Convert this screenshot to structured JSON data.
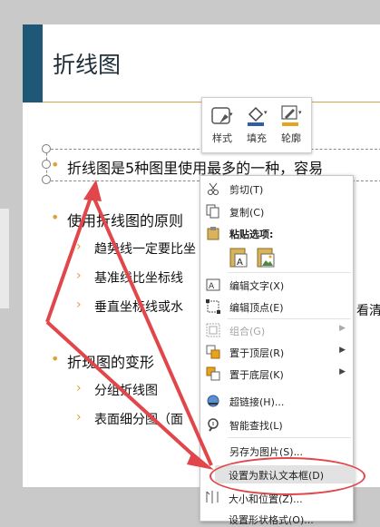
{
  "slide": {
    "title": "折线图",
    "bullets": [
      {
        "text": "折线图是5种图里使用最多的一种，容易"
      },
      {
        "text": "使用折线图的原则"
      },
      {
        "text": "折现图的变形"
      }
    ],
    "sub1": [
      "趋势线一定要比坐",
      "基准线比坐标线",
      "垂直坐标线或水",
      "看清"
    ],
    "sub3": [
      "分组折线图",
      "表面细分图（面"
    ]
  },
  "mini_toolbar": {
    "style_label": "样式",
    "fill_label": "填充",
    "outline_label": "轮廓",
    "fill_color": "#2e5fa6",
    "outline_color": "#e8a21e"
  },
  "context_menu": {
    "cut": "剪切(T)",
    "copy": "复制(C)",
    "paste_options": "粘贴选项:",
    "edit_text": "编辑文字(X)",
    "edit_points": "编辑顶点(E)",
    "group": "组合(G)",
    "bring_front": "置于顶层(R)",
    "send_back": "置于底层(K)",
    "hyperlink": "超链接(H)...",
    "smart_lookup": "智能查找(L)",
    "save_as_picture": "另存为图片(S)...",
    "set_default_textbox": "设置为默认文本框(D)",
    "size_position": "大小和位置(Z)...",
    "format_shape": "设置形状格式(O)..."
  },
  "colors": {
    "title_bar": "#1f5876",
    "accent": "#e0a234",
    "annotation_red": "#e1474a"
  }
}
